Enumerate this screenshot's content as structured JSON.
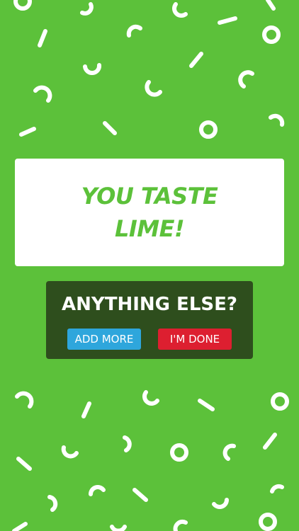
{
  "result": {
    "line1": "YOU TASTE",
    "line2": "LIME!"
  },
  "prompt": {
    "title": "ANYTHING ELSE?",
    "add_more_label": "ADD MORE",
    "done_label": "I'M DONE"
  },
  "colors": {
    "background": "#5cc13a",
    "accent_text": "#5cc13a",
    "panel": "#2e4e1d",
    "add_more": "#2ea6dc",
    "done": "#dd1f30",
    "confetti": "#ffffff"
  }
}
